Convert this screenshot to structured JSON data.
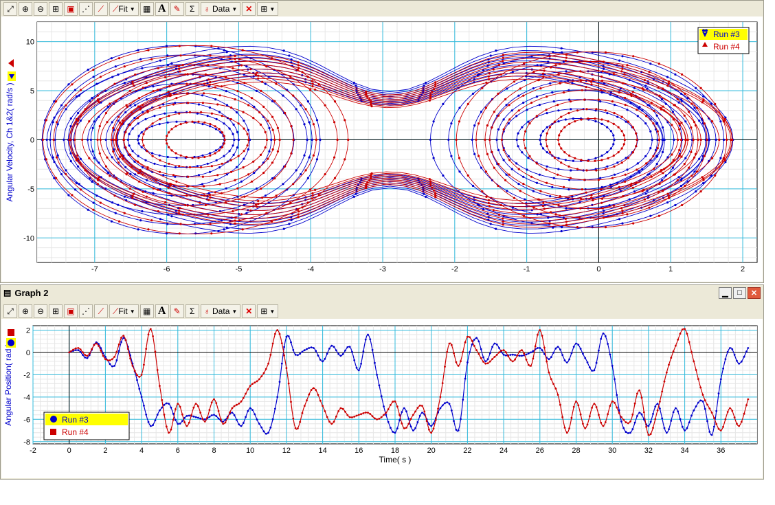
{
  "toolbar": {
    "fit_label": "Fit",
    "data_label": "Data",
    "icons": [
      "autoscale-icon",
      "zoom-in-icon",
      "zoom-out-icon",
      "zoom-box-icon",
      "lock-icon",
      "examine-icon",
      "tangent-icon",
      "curve-fit-icon",
      "calculator-icon",
      "annotation-icon",
      "highlight-icon",
      "statistics-icon",
      "data-select-icon",
      "delete-icon",
      "graph-options-icon"
    ]
  },
  "graph2": {
    "title": "Graph 2"
  },
  "colors": {
    "run3": "#0000cc",
    "run4": "#cc0000",
    "grid": "#33bbdd",
    "minorgrid": "#e6e6e6",
    "legend_highlight": "#ffff00"
  },
  "chart_data": [
    {
      "type": "line",
      "subtype": "phase-plot",
      "xlabel": "",
      "ylabel": "Angular Velocity, Ch 1&2( rad/s )",
      "xlim": [
        -7.8,
        2.2
      ],
      "ylim": [
        -12.5,
        12
      ],
      "x_ticks": [
        "-7",
        "-6",
        "-5",
        "-4",
        "-3",
        "-2",
        "-1",
        "0",
        "1",
        "2"
      ],
      "y_ticks": [
        "10",
        "5",
        "0",
        "-5",
        "-10"
      ],
      "legend_position": "top-right",
      "legend": [
        {
          "name": "Run #3",
          "marker": "heart"
        },
        {
          "name": "Run #4",
          "marker": "triangle"
        }
      ],
      "series": [
        {
          "name": "Run #3",
          "color": "#0000cc",
          "left_center": [
            -5.8,
            0
          ],
          "right_center": [
            -0.3,
            0
          ],
          "outer_x_range": [
            -7.7,
            1.9
          ],
          "outer_y_range": [
            -11,
            11
          ]
        },
        {
          "name": "Run #4",
          "color": "#cc0000",
          "left_center": [
            -5.6,
            0
          ],
          "right_center": [
            -0.1,
            0
          ],
          "outer_x_range": [
            -7.5,
            2.0
          ],
          "outer_y_range": [
            -11,
            10.2
          ]
        }
      ]
    },
    {
      "type": "line",
      "xlabel": "Time( s )",
      "ylabel": "Angular Position( rad )",
      "xlim": [
        -2,
        38
      ],
      "ylim": [
        -8.2,
        2.4
      ],
      "x_ticks": [
        "-2",
        "0",
        "2",
        "4",
        "6",
        "8",
        "10",
        "12",
        "14",
        "16",
        "18",
        "20",
        "22",
        "24",
        "26",
        "28",
        "30",
        "32",
        "34",
        "36"
      ],
      "y_ticks": [
        "2",
        "0",
        "-2",
        "-4",
        "-6",
        "-8"
      ],
      "legend_position": "bottom-left",
      "legend": [
        {
          "name": "Run #3",
          "marker": "circle"
        },
        {
          "name": "Run #4",
          "marker": "square"
        }
      ],
      "series": [
        {
          "name": "Run #3",
          "color": "#0000cc",
          "t": [
            0,
            0.5,
            1,
            1.5,
            2,
            2.5,
            3,
            3.5,
            4,
            4.5,
            5,
            5.5,
            6,
            6.5,
            7,
            7.5,
            8,
            8.5,
            9,
            9.5,
            10,
            10.5,
            11,
            11.5,
            12,
            12.5,
            13,
            13.5,
            14,
            14.5,
            15,
            15.5,
            16,
            16.5,
            17,
            17.5,
            18,
            18.5,
            19,
            19.5,
            20,
            20.5,
            21,
            21.5,
            22,
            22.5,
            23,
            23.5,
            24,
            24.5,
            25,
            25.5,
            26,
            26.5,
            27,
            27.5,
            28,
            28.5,
            29,
            29.5,
            30,
            30.5,
            31,
            31.5,
            32,
            32.5,
            33,
            33.5,
            34,
            34.5,
            35,
            35.5,
            36,
            36.5,
            37,
            37.5
          ],
          "theta": [
            0,
            0.2,
            -0.5,
            0.9,
            -0.4,
            -1.2,
            1.3,
            -1.0,
            -4.0,
            -6.6,
            -5.2,
            -4.6,
            -6.4,
            -5.7,
            -5.8,
            -6.0,
            -5.6,
            -6.2,
            -5.4,
            -6.6,
            -5.0,
            -6.4,
            -7.2,
            -4.0,
            1.4,
            -0.2,
            0.2,
            0.4,
            -0.8,
            0.6,
            -0.3,
            0.5,
            -1.6,
            1.6,
            -2.0,
            -5.6,
            -7.2,
            -5.0,
            -7.0,
            -5.4,
            -6.6,
            -5.0,
            -4.6,
            -7.0,
            -0.9,
            1.3,
            -0.8,
            0.8,
            -0.2,
            -0.2,
            -0.3,
            0.0,
            0.4,
            -0.6,
            0.5,
            -0.9,
            0.8,
            -0.5,
            -1.6,
            1.7,
            -1.2,
            -6.2,
            -7.2,
            -5.4,
            -6.6,
            -4.6,
            -7.2,
            -5.0,
            -7.0,
            -5.2,
            -4.4,
            -7.4,
            -2.4,
            0.4,
            -1.0,
            0.4
          ]
        },
        {
          "name": "Run #4",
          "color": "#cc0000",
          "t": [
            0,
            0.5,
            1,
            1.5,
            2,
            2.5,
            3,
            3.5,
            4,
            4.5,
            5,
            5.5,
            6,
            6.5,
            7,
            7.5,
            8,
            8.5,
            9,
            9.5,
            10,
            10.5,
            11,
            11.5,
            12,
            12.5,
            13,
            13.5,
            14,
            14.5,
            15,
            15.5,
            16,
            16.5,
            17,
            17.5,
            18,
            18.5,
            19,
            19.5,
            20,
            20.5,
            21,
            21.5,
            22,
            22.5,
            23,
            23.5,
            24,
            24.5,
            25,
            25.5,
            26,
            26.5,
            27,
            27.5,
            28,
            28.5,
            29,
            29.5,
            30,
            30.5,
            31,
            31.5,
            32,
            32.5,
            33,
            33.5,
            34,
            34.5,
            35,
            35.5,
            36,
            36.5,
            37,
            37.5
          ],
          "theta": [
            0,
            0.4,
            -0.3,
            0.8,
            -0.6,
            -0.4,
            1.5,
            -1.2,
            -2.0,
            2.1,
            -3.0,
            -7.2,
            -4.6,
            -6.6,
            -4.6,
            -6.2,
            -4.2,
            -6.4,
            -5.0,
            -4.4,
            -3.0,
            -2.4,
            -1.0,
            2.0,
            -1.4,
            -6.8,
            -4.8,
            -3.2,
            -4.8,
            -6.4,
            -5.0,
            -5.8,
            -5.6,
            -5.4,
            -6.0,
            -5.4,
            -4.4,
            -6.8,
            -5.6,
            -4.8,
            -7.2,
            -4.0,
            0.8,
            -1.2,
            1.4,
            0.2,
            -1.0,
            -0.4,
            0.2,
            -0.8,
            0.2,
            -1.2,
            2.0,
            -1.8,
            -3.8,
            -7.2,
            -4.4,
            -6.8,
            -4.6,
            -6.6,
            -4.4,
            -5.8,
            -6.2,
            -3.4,
            -7.4,
            -5.2,
            -1.8,
            0.6,
            2.1,
            -0.8,
            -3.8,
            -5.4,
            -7.0,
            -5.0,
            -6.6,
            -4.2
          ]
        }
      ]
    }
  ]
}
